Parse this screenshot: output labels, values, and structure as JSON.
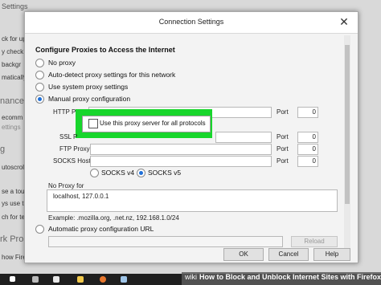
{
  "background": {
    "title_fragment": "Settings",
    "sidebar_fragments": [
      "ck for up",
      "y check",
      "backgr",
      "matically",
      "nance",
      "ecomm",
      "ettings",
      "g",
      "utoscrol",
      "se a touch",
      "ys use th",
      "ch for tex",
      "rk Pro",
      "how Firefox"
    ]
  },
  "dialog": {
    "title": "Connection Settings",
    "close_glyph": "✕",
    "section_title": "Configure Proxies to Access the Internet",
    "options": [
      {
        "label": "No proxy",
        "selected": false
      },
      {
        "label": "Auto-detect proxy settings for this network",
        "selected": false
      },
      {
        "label": "Use system proxy settings",
        "selected": false
      },
      {
        "label": "Manual proxy configuration",
        "selected": true
      }
    ],
    "http_label": "HTTP P",
    "ssl_label": "SSL P",
    "ftp_label": "FTP Proxy",
    "socks_label": "SOCKS Host",
    "port_label": "Port",
    "port_values": [
      "0",
      "0",
      "0",
      "0"
    ],
    "highlight_checkbox_label": "Use this proxy server for all protocols",
    "socks_v4": "SOCKS v4",
    "socks_v5": "SOCKS v5",
    "no_proxy_label": "No Proxy for",
    "no_proxy_value": "localhost, 127.0.0.1",
    "example_text": "Example: .mozilla.org, .net.nz, 192.168.1.0/24",
    "auto_config_label": "Automatic proxy configuration URL",
    "reload_label": "Reload",
    "ok_label": "OK",
    "cancel_label": "Cancel",
    "help_label": "Help"
  },
  "watermark": {
    "brand": "wiki",
    "text": "How to Block and Unblock Internet Sites with Firefox"
  },
  "colors": {
    "highlight_green": "#18d62c",
    "radio_selected": "#1e6fd8"
  }
}
